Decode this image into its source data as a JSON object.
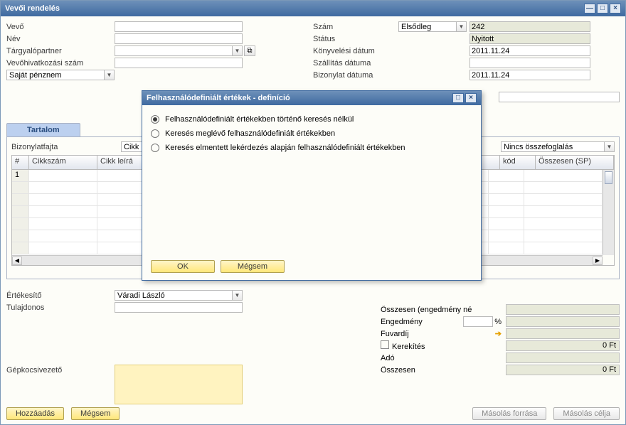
{
  "window": {
    "title": "Vevői rendelés"
  },
  "left_fields": {
    "vevo": "Vevő",
    "nev": "Név",
    "targyalo": "Tárgyalópartner",
    "vevoszam": "Vevőhivatkozási szám",
    "penznem_value": "Saját pénznem"
  },
  "right_fields": {
    "szam": "Szám",
    "szam_sel": "Elsődleg",
    "szam_val": "242",
    "status": "Státus",
    "status_val": "Nyitott",
    "konyv": "Könyvelési dátum",
    "konyv_val": "2011.11.24",
    "szallitas": "Szállítás dátuma",
    "bizonylat": "Bizonylat dátuma",
    "bizonylat_val": "2011.11.24"
  },
  "tabs": {
    "tartalom": "Tartalom"
  },
  "grid": {
    "bizonylatfajta": "Bizonylatfajta",
    "biz_val": "Cikk",
    "summary": "Nincs összefoglalás",
    "cols": {
      "num": "#",
      "cikkszam": "Cikkszám",
      "leiras": "Cikk leírá",
      "kod": "kód",
      "osszesen": "Összesen (SP)"
    },
    "row1_num": "1"
  },
  "sales": {
    "ertekesito": "Értékesítő",
    "ertekesito_val": "Váradi László",
    "tulajdonos": "Tulajdonos",
    "gepkocsi": "Gépkocsivezető"
  },
  "totals": {
    "osszesen_eng": "Összesen (engedmény né",
    "engedmeny": "Engedmény",
    "pct": "%",
    "fuvar": "Fuvardíj",
    "kerekites": "Kerekítés",
    "kerekites_val": "0 Ft",
    "ado": "Adó",
    "osszesen": "Összesen",
    "osszesen_val": "0 Ft"
  },
  "buttons": {
    "hozzaadas": "Hozzáadás",
    "megsem": "Mégsem",
    "masol_forras": "Másolás forrása",
    "masol_cel": "Másolás célja"
  },
  "dialog": {
    "title": "Felhasználódefiniált értékek - definíció",
    "opt1": "Felhasználódefiniált értékekben történő keresés nélkül",
    "opt2": "Keresés meglévő felhasználódefiniált értékekben",
    "opt3": "Keresés elmentett lekérdezés alapján felhasználódefiniált értékekben",
    "ok": "OK",
    "megsem": "Mégsem"
  }
}
